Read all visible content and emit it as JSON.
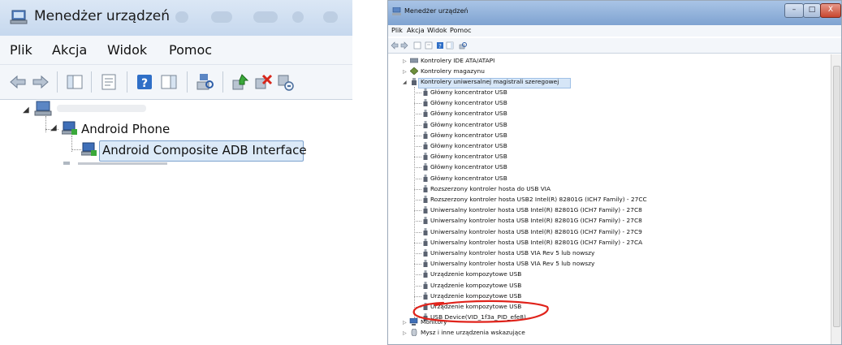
{
  "left": {
    "window_title": "Menedżer urządzeń",
    "menu": [
      "Plik",
      "Akcja",
      "Widok",
      "Pomoc"
    ],
    "tree": {
      "group_label": "Android Phone",
      "device_label": "Android Composite ADB Interface"
    }
  },
  "right": {
    "window_title": "Menedżer urządzeń",
    "window_buttons": [
      "–",
      "□",
      "X"
    ],
    "menu": [
      "Plik",
      "Akcja",
      "Widok",
      "Pomoc"
    ],
    "tree": {
      "categories_top": [
        "Kontrolery IDE ATA/ATAPI",
        "Kontrolery magazynu"
      ],
      "expanded_category": "Kontrolery uniwersalnej magistrali szeregowej",
      "usb_items": [
        "Główny koncentrator USB",
        "Główny koncentrator USB",
        "Główny koncentrator USB",
        "Główny koncentrator USB",
        "Główny koncentrator USB",
        "Główny koncentrator USB",
        "Główny koncentrator USB",
        "Główny koncentrator USB",
        "Główny koncentrator USB",
        "Rozszerzony kontroler hosta do USB VIA",
        "Rozszerzony kontroler hosta USB2 Intel(R) 82801G (ICH7 Family) - 27CC",
        "Uniwersalny kontroler hosta USB Intel(R) 82801G (ICH7 Family) - 27C8",
        "Uniwersalny kontroler hosta USB Intel(R) 82801G (ICH7 Family) - 27C8",
        "Uniwersalny kontroler hosta USB Intel(R) 82801G (ICH7 Family) - 27C9",
        "Uniwersalny kontroler hosta USB Intel(R) 82801G (ICH7 Family) - 27CA",
        "Uniwersalny kontroler hosta USB VIA Rev 5 lub nowszy",
        "Uniwersalny kontroler hosta USB VIA Rev 5 lub nowszy",
        "Urządzenie kompozytowe USB",
        "Urządzenie kompozytowe USB",
        "Urządzenie kompozytowe USB",
        "Urządzenie kompozytowe USB",
        "USB Device(VID_1f3a_PID_efe8)"
      ],
      "categories_bottom": [
        "Monitory",
        "Mysz i inne urządzenia wskazujące"
      ]
    }
  },
  "colors": {
    "annotation": "#e0231b",
    "selection": "#dceaf8",
    "titlebar": "#a9c4e6"
  }
}
